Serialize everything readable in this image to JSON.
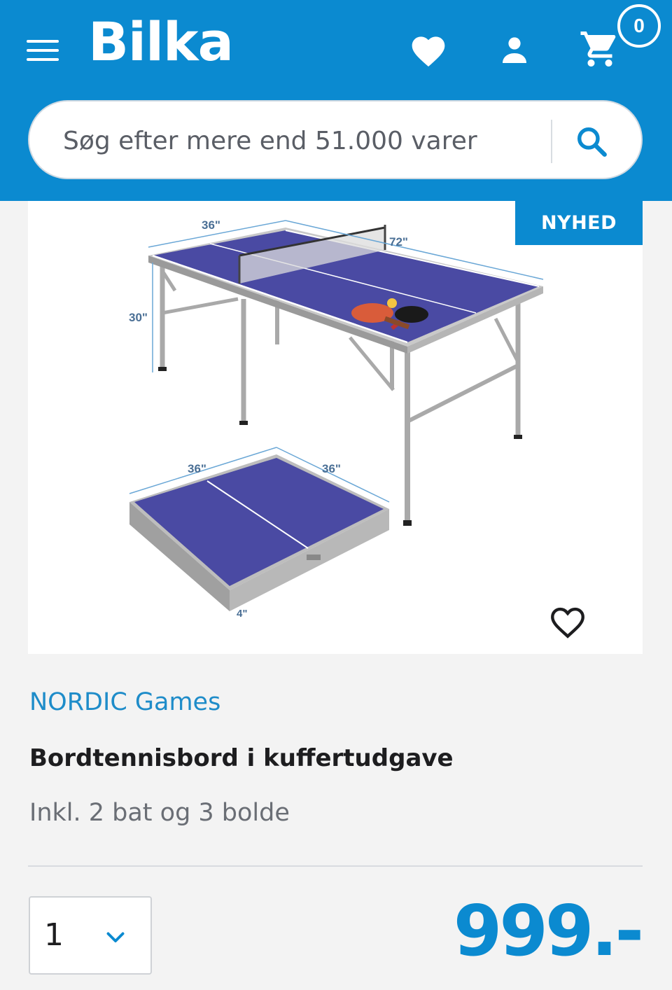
{
  "header": {
    "logo": "Bilka",
    "cart_count": "0",
    "icons": {
      "menu": "hamburger-menu-icon",
      "wishlist": "heart-icon",
      "account": "user-icon",
      "cart": "shopping-cart-icon"
    }
  },
  "search": {
    "placeholder": "Søg efter mere end 51.000 varer",
    "icon": "search-icon"
  },
  "product": {
    "badge": "NYHED",
    "image_labels": {
      "width_top": "36\"",
      "length": "72\"",
      "height": "30\"",
      "folded_left": "36\"",
      "folded_right": "36\"",
      "folded_depth": "4\""
    },
    "brand": "NORDIC Games",
    "title": "Bordtennisbord i kuffertudgave",
    "subtitle": "Inkl. 2 bat og 3 bolde",
    "quantity": "1",
    "price": "999.-"
  },
  "colors": {
    "brand_blue": "#0b8ad0",
    "table_blue": "#4a4aa3",
    "link_blue": "#1e8cc9"
  }
}
